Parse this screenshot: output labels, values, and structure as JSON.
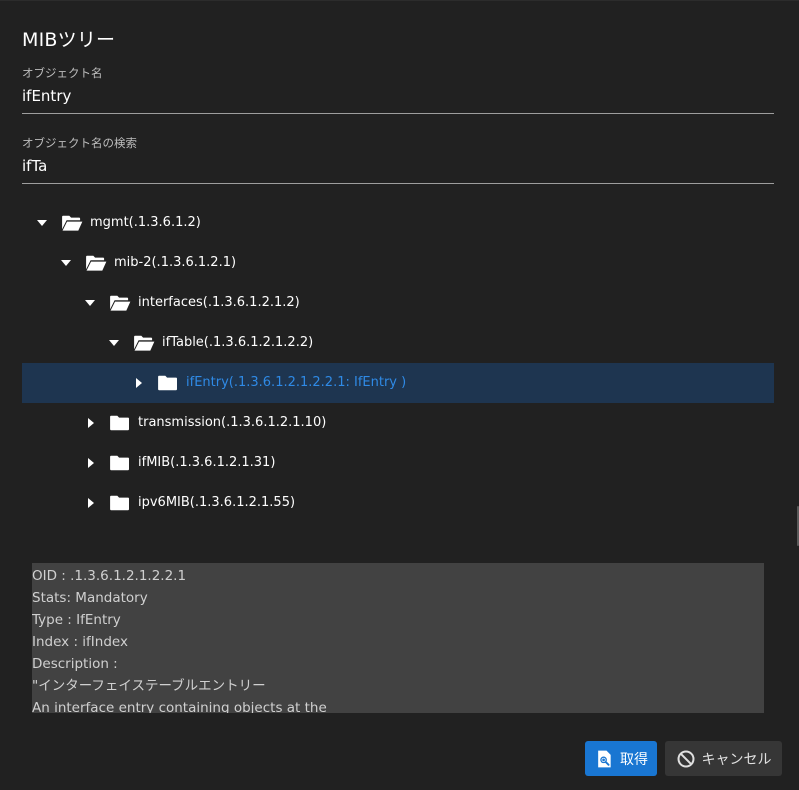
{
  "dialog": {
    "title": "MIBツリー"
  },
  "object_name": {
    "label": "オブジェクト名",
    "value": "ifEntry"
  },
  "object_search": {
    "label": "オブジェクト名の検索",
    "value": "ifTa"
  },
  "tree": {
    "nodes": [
      {
        "label": "mgmt(.1.3.6.1.2)",
        "expanded": true,
        "level": 0
      },
      {
        "label": "mib-2(.1.3.6.1.2.1)",
        "expanded": true,
        "level": 1
      },
      {
        "label": "interfaces(.1.3.6.1.2.1.2)",
        "expanded": true,
        "level": 2
      },
      {
        "label": "ifTable(.1.3.6.1.2.1.2.2)",
        "expanded": true,
        "level": 3
      },
      {
        "label": "ifEntry(.1.3.6.1.2.1.2.2.1: IfEntry )",
        "expanded": false,
        "level": 4,
        "selected": true
      },
      {
        "label": "transmission(.1.3.6.1.2.1.10)",
        "expanded": false,
        "level": 2
      },
      {
        "label": "ifMIB(.1.3.6.1.2.1.31)",
        "expanded": false,
        "level": 2
      },
      {
        "label": "ipv6MIB(.1.3.6.1.2.1.55)",
        "expanded": false,
        "level": 2
      }
    ]
  },
  "info": {
    "lines": [
      "OID  : .1.3.6.1.2.1.2.2.1",
      "Stats: Mandatory",
      "Type : IfEntry",
      "Index : ifIndex",
      "Description :",
      "\"インターフェイステーブルエントリー",
      "An interface entry containing objects at the"
    ]
  },
  "buttons": {
    "get_label": "取得",
    "cancel_label": "キャンセル"
  },
  "colors": {
    "dialog_bg": "#212121",
    "selected_row_bg": "#1e3550",
    "selected_text": "#2f8ae6",
    "primary_button": "#1976d2",
    "info_bg": "#424242"
  }
}
